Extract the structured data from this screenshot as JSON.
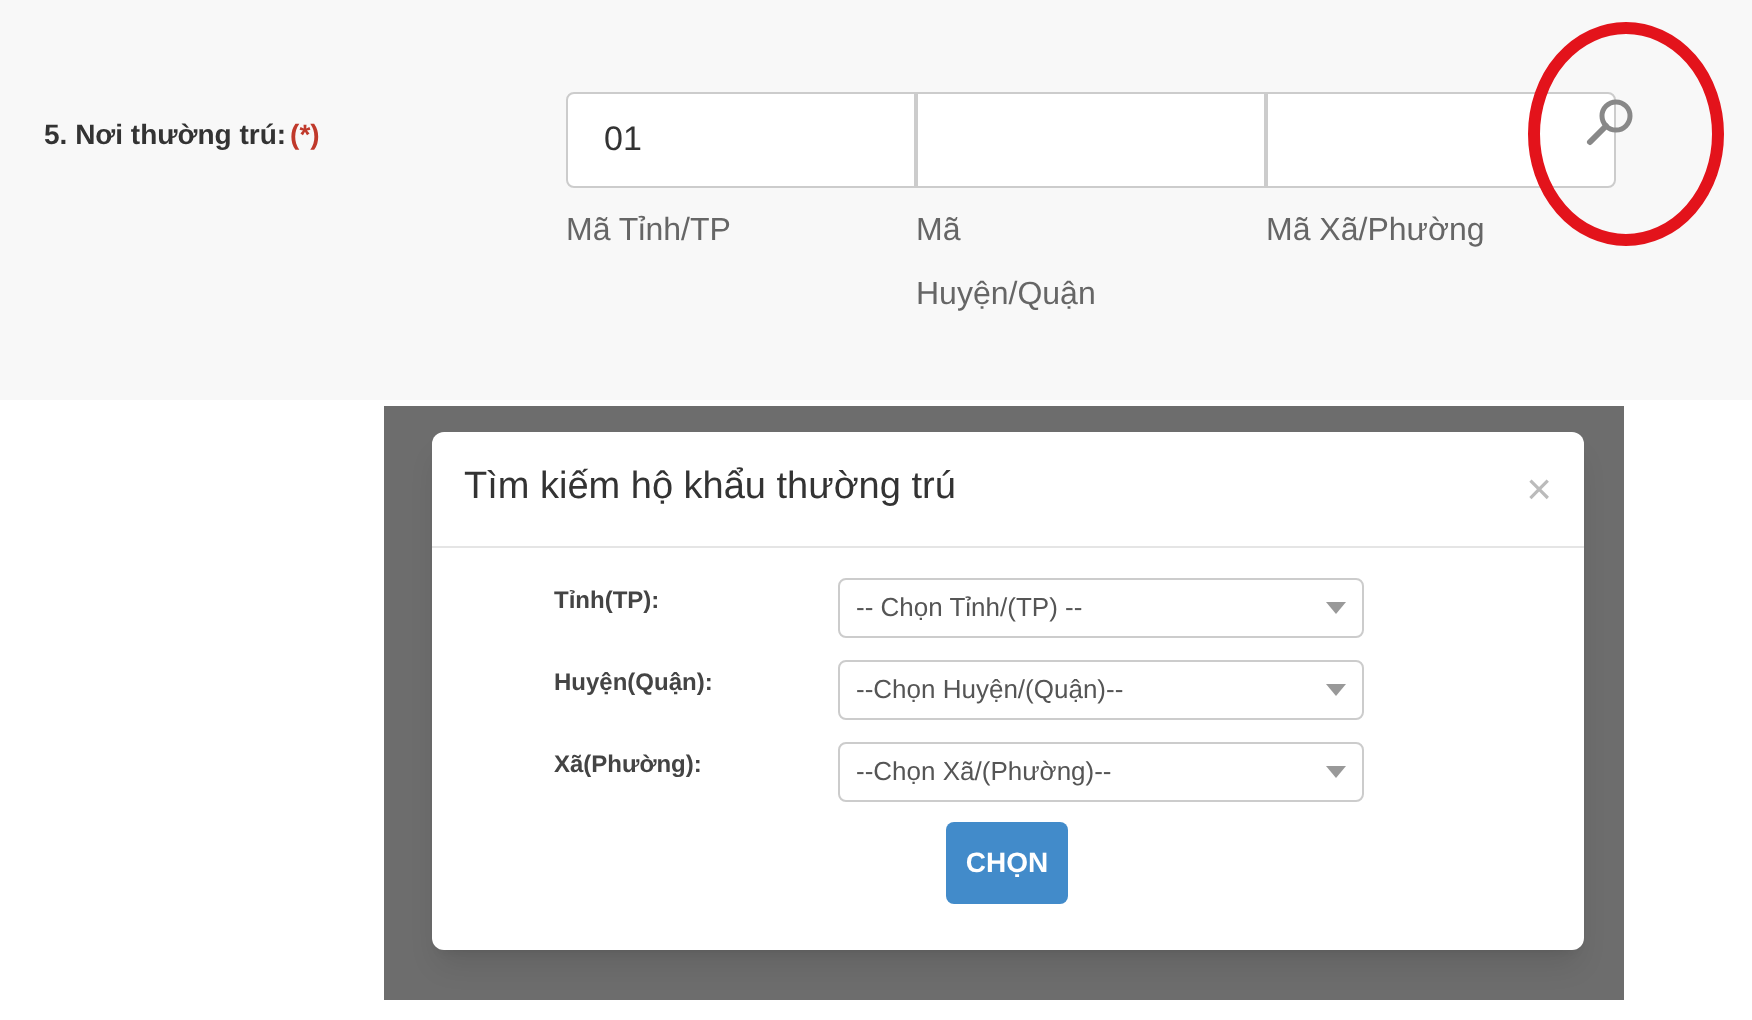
{
  "field": {
    "label": "5. Nơi thường trú:",
    "required_mark": "(*)",
    "inputs": [
      {
        "value": "01",
        "caption": "Mã Tỉnh/TP"
      },
      {
        "caption": "Mã Huyện/Quận"
      },
      {
        "caption": "Mã Xã/Phường"
      }
    ],
    "highlighted": true
  },
  "dialog": {
    "title": "Tìm kiếm hộ khẩu thường trú",
    "close": "×",
    "rows": [
      {
        "label": "Tỉnh(TP):",
        "value": "-- Chọn Tỉnh/(TP) --"
      },
      {
        "label": "Huyện(Quận):",
        "value": "--Chọn Huyện/(Quận)--"
      },
      {
        "label": "Xã(Phường):",
        "value": "--Chọn Xã/(Phường)--"
      }
    ],
    "button": "CHỌN"
  }
}
